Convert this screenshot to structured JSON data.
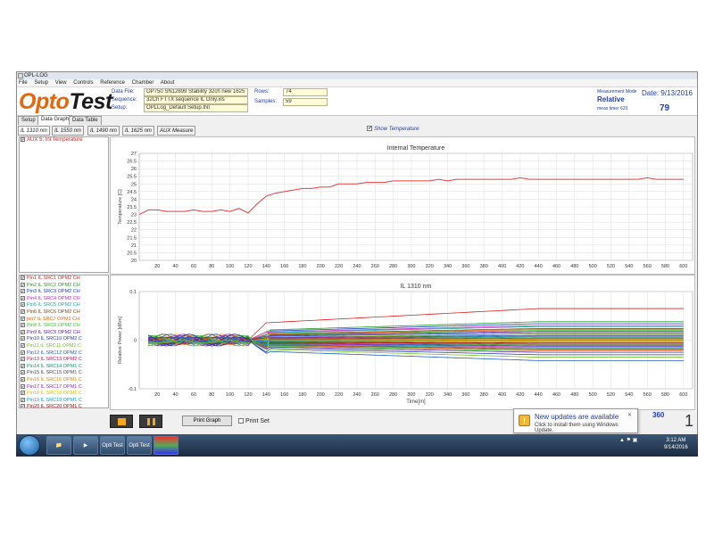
{
  "window": {
    "title": "OPL-LOG"
  },
  "menu": [
    "File",
    "Setup",
    "View",
    "Controls",
    "Reference",
    "Chamber",
    "About"
  ],
  "logo": {
    "part1": "Opto",
    "part2": "Test"
  },
  "fields": {
    "data_file_label": "Data File:",
    "data_file_value": "OP750 SN12899 Stability 32ch new 1625",
    "sequence_label": "Sequence:",
    "sequence_value": "32Ch FTTX sequence IL Only.xls",
    "setup_label": "Setup:",
    "setup_value": "OPLLog_Default Setup.INI",
    "rows_label": "Rows:",
    "rows_value": "74",
    "samples_label": "Samples:",
    "samples_value": "59"
  },
  "status": {
    "measurement_mode_label": "Measurement Mode",
    "measurement_mode_value": "Relative",
    "date": "Date: 9/13/2016",
    "timer_label": "meas timer 620",
    "timer_value": "79"
  },
  "tabs": [
    "Setup",
    "Data Graph",
    "Data Table"
  ],
  "subtabs": [
    "IL 1310 nm",
    "IL 1550 nm",
    "IL 1490 nm",
    "IL 1625 nm",
    "AUX Measure"
  ],
  "show_temperature": "Show Temperature",
  "aux_item": "AUX 5: Int Temperature",
  "channels": [
    {
      "label": "Pin1 IL SRC1 OPM2 CH",
      "color": "#d42020"
    },
    {
      "label": "Pin2 IL SRC2 OPM2 CH",
      "color": "#2a9a2a"
    },
    {
      "label": "Pin3 IL SRC3 OPM2 CH",
      "color": "#1b3fc8"
    },
    {
      "label": "Pin4 IL SRC4 OPM2 CH",
      "color": "#c32fc3"
    },
    {
      "label": "Pin5 IL SRC5 OPM2 CH",
      "color": "#1fa7a7"
    },
    {
      "label": "Pin6 IL SRC6 OPM2 CH",
      "color": "#7a4a14"
    },
    {
      "label": "pin7 IL SRC7 OPM2 CH",
      "color": "#e8650a"
    },
    {
      "label": "Pin8 IL SRC8 OPM2 CH",
      "color": "#4ac44a"
    },
    {
      "label": "Pin9 IL SRC9 OPM2 CH",
      "color": "#5a1fa0"
    },
    {
      "label": "Pin10 IL SRC10 OPM2 C",
      "color": "#1f3f9f"
    },
    {
      "label": "Pin11 IL SRC11 OPM2 C",
      "color": "#7cc022"
    },
    {
      "label": "Pin12 IL SRC12 OPM2 C",
      "color": "#2060c0"
    },
    {
      "label": "Pin13 IL SRC13 OPM2 C",
      "color": "#c01860"
    },
    {
      "label": "Pin14 IL SRC14 OPM1 C",
      "color": "#1a9a6a"
    },
    {
      "label": "Pin15 IL SRC15 OPM1 C",
      "color": "#4a4a4a"
    },
    {
      "label": "Pin16 IL SRC16 OPM1 C",
      "color": "#d88a10"
    },
    {
      "label": "Pin17 IL SRC17 OPM1 C",
      "color": "#8a2ad8"
    },
    {
      "label": "Pin18 IL SRC18 OPM1 C",
      "color": "#d8c010"
    },
    {
      "label": "Pin19 IL SRC19 OPM1 C",
      "color": "#10a0d8"
    },
    {
      "label": "Pin20 IL SRC20 OPM1 C",
      "color": "#a01010"
    }
  ],
  "chart_data": [
    {
      "type": "line",
      "title": "Internal Temperature",
      "ylabel": "Temperature [C]",
      "xlabel": "",
      "xlim": [
        0,
        610
      ],
      "ylim": [
        20,
        27
      ],
      "xticks": [
        20,
        40,
        60,
        80,
        100,
        120,
        140,
        160,
        180,
        200,
        220,
        240,
        260,
        280,
        300,
        320,
        340,
        360,
        380,
        400,
        420,
        440,
        460,
        480,
        500,
        520,
        540,
        560,
        580,
        600
      ],
      "yticks": [
        20,
        20.5,
        21,
        21.5,
        22,
        22.5,
        23,
        23.5,
        24,
        24.5,
        25,
        25.5,
        26,
        26.5,
        27
      ],
      "grid": true,
      "series": [
        {
          "color": "#e04040",
          "x": [
            0,
            10,
            20,
            30,
            40,
            50,
            60,
            70,
            80,
            90,
            100,
            110,
            120,
            130,
            140,
            150,
            160,
            170,
            180,
            190,
            200,
            210,
            220,
            230,
            240,
            250,
            260,
            270,
            280,
            290,
            300,
            310,
            320,
            330,
            340,
            350,
            360,
            370,
            380,
            390,
            400,
            410,
            420,
            430,
            440,
            450,
            460,
            470,
            480,
            490,
            500,
            510,
            520,
            530,
            540,
            550,
            560,
            570,
            580,
            600
          ],
          "y": [
            23.0,
            23.3,
            23.3,
            23.2,
            23.2,
            23.2,
            23.3,
            23.2,
            23.2,
            23.3,
            23.2,
            23.4,
            23.1,
            23.7,
            24.2,
            24.4,
            24.5,
            24.6,
            24.7,
            24.7,
            24.8,
            24.8,
            25.0,
            25.0,
            25.0,
            25.1,
            25.1,
            25.1,
            25.2,
            25.2,
            25.2,
            25.2,
            25.2,
            25.3,
            25.2,
            25.3,
            25.3,
            25.3,
            25.3,
            25.3,
            25.3,
            25.3,
            25.4,
            25.3,
            25.3,
            25.3,
            25.3,
            25.3,
            25.3,
            25.3,
            25.3,
            25.3,
            25.3,
            25.3,
            25.3,
            25.3,
            25.4,
            25.3,
            25.3,
            25.3
          ]
        }
      ]
    },
    {
      "type": "line",
      "title": "IL 1310 nm",
      "ylabel": "Relative Power [dBm]",
      "xlabel": "Time[m]",
      "xlim": [
        0,
        610
      ],
      "ylim": [
        -0.1,
        0.1
      ],
      "xticks": [
        20,
        40,
        60,
        80,
        100,
        120,
        140,
        160,
        180,
        200,
        220,
        240,
        260,
        280,
        300,
        320,
        340,
        360,
        380,
        400,
        420,
        440,
        460,
        480,
        500,
        520,
        540,
        560,
        580,
        600
      ],
      "yticks": [
        -0.1,
        0,
        0.1
      ],
      "ytick_labels": [
        "-0.1",
        "0",
        "0.1"
      ],
      "grid": true,
      "series_final": [
        0.065,
        0.038,
        0.034,
        0.03,
        0.028,
        0.024,
        0.022,
        0.02,
        0.018,
        0.015,
        0.012,
        0.01,
        0.008,
        0.006,
        0.004,
        0.002,
        0.0,
        -0.002,
        -0.004,
        -0.006,
        -0.008,
        -0.01,
        -0.012,
        -0.014,
        -0.016,
        -0.018,
        -0.02,
        -0.022,
        -0.025,
        -0.03,
        -0.035,
        -0.042
      ]
    }
  ],
  "buttons": {
    "print_graph": "Print Graph",
    "print_set": "Print Set"
  },
  "counters": {
    "a": "360",
    "b": "1"
  },
  "notification": {
    "title": "New updates are available",
    "body": "Click to install them using Windows Update."
  },
  "taskbar": {
    "apps": [
      {
        "name": "Opti",
        "label": "Opti Test"
      },
      {
        "name": "Opti2",
        "label": "Opti Test"
      }
    ],
    "clock_time": "3:12 AM",
    "clock_date": "9/14/2016"
  }
}
